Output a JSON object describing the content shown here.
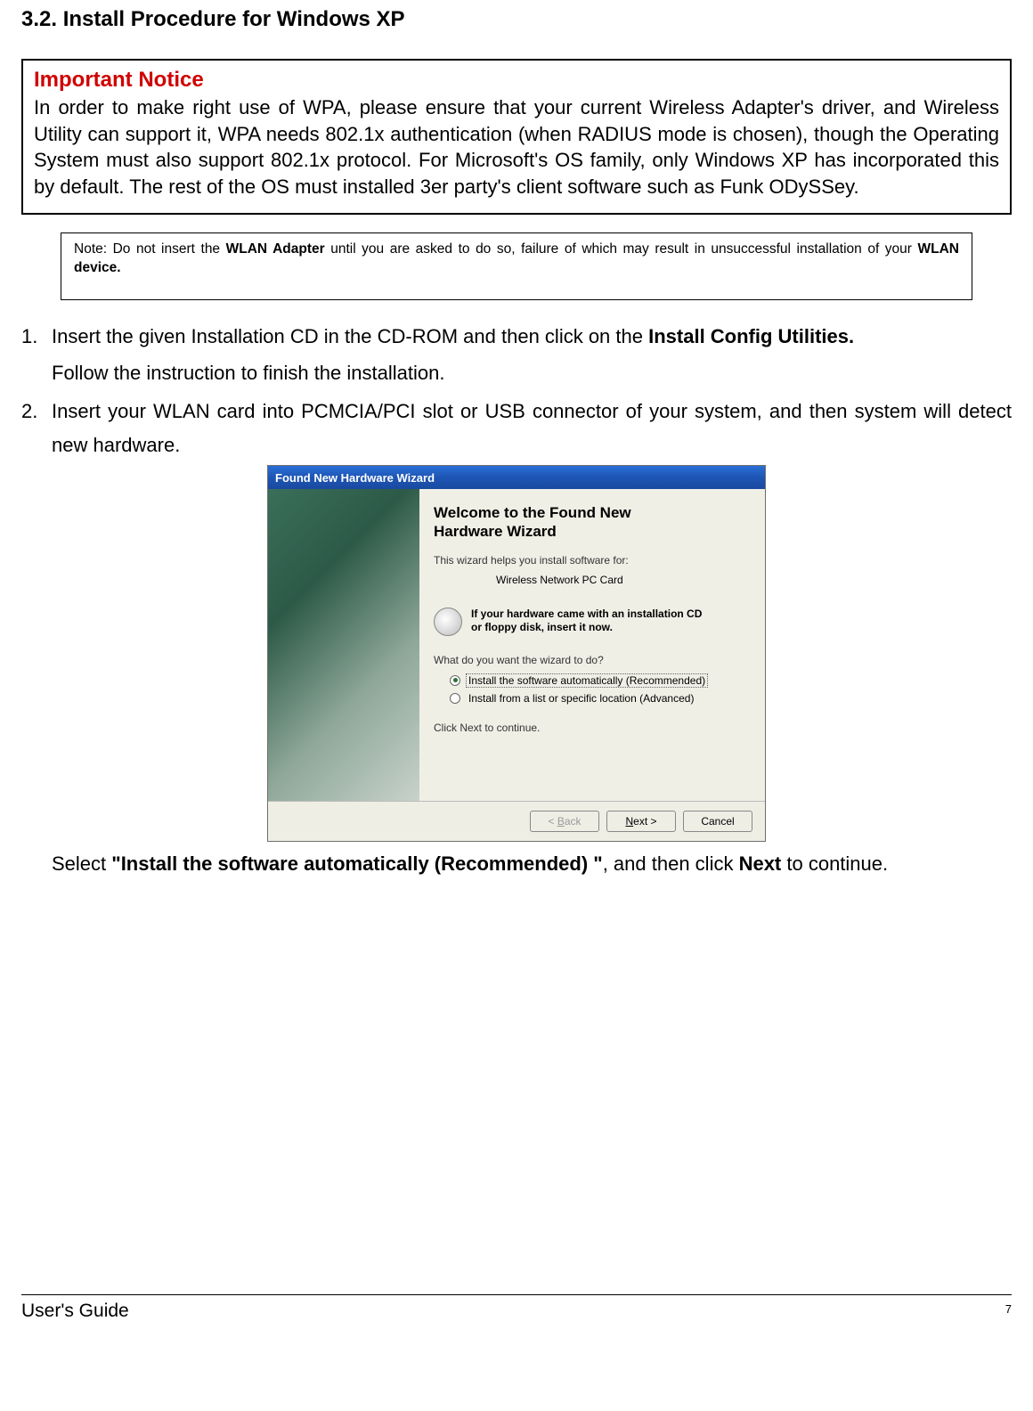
{
  "section_heading": "3.2. Install Procedure for Windows XP",
  "important": {
    "title": "Important Notice",
    "body": "In order to make right use of WPA, please ensure that your current Wireless Adapter's driver, and Wireless Utility can support it, WPA needs 802.1x authentication (when RADIUS mode is chosen), though the Operating System must also support 802.1x protocol. For Microsoft's OS family, only Windows XP has incorporated this by default. The rest of the OS must installed 3er party's client software such as Funk ODySSey."
  },
  "note": {
    "prefix": "Note: Do not insert the ",
    "bold1": "WLAN Adapter",
    "mid": " until you are asked to do so, failure of which may result in unsuccessful installation of your ",
    "bold2": "WLAN device."
  },
  "steps": {
    "s1_num": "1.",
    "s1_a": "Insert the given Installation CD in the CD-ROM and then click on the ",
    "s1_b_bold": "Install Config Utilities.",
    "s1_follow": "Follow the instruction to finish the installation.",
    "s2_num": "2.",
    "s2_text": "Insert your WLAN card into PCMCIA/PCI slot or USB connector of your system, and then system will detect new hardware."
  },
  "wizard": {
    "title": "Found New Hardware Wizard",
    "heading_l1": "Welcome to the Found New",
    "heading_l2": "Hardware Wizard",
    "helps": "This wizard helps you install software for:",
    "device": "Wireless Network PC Card",
    "cd_line1": "If your hardware came with an installation CD",
    "cd_line2": "or floppy disk, insert it now.",
    "question": "What do you want the wizard to do?",
    "opt1": "Install the software automatically (Recommended)",
    "opt2": "Install from a list or specific location (Advanced)",
    "click_next": "Click Next to continue.",
    "btn_back": "< Back",
    "btn_next": "Next >",
    "btn_cancel": "Cancel"
  },
  "post": {
    "a": "Select ",
    "b_bold": "\"Install the software automatically (Recommended) \"",
    "c": ", and then click ",
    "d_bold": "Next",
    "e": " to continue."
  },
  "footer": {
    "left": "User's Guide",
    "page": "7"
  }
}
